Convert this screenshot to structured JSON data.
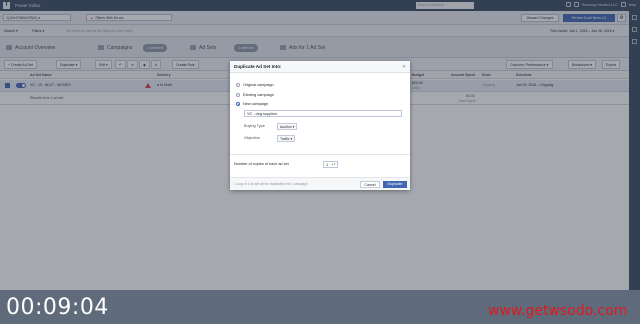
{
  "topbar": {
    "app_name": "Power Editor",
    "search_placeholder": "Search business",
    "account_name": "Runaway Vendors LLC",
    "help": "Help"
  },
  "subbar": {
    "account_id": "1(10047580497804) ▾",
    "filter_label": "Filters With Errors",
    "discard_label": "Discard Changes",
    "review_label": "Review Draft Items (1)"
  },
  "rowbar": {
    "search": "Search ▾",
    "filters": "Filters ▾",
    "hint": "Set filters to narrow the data you see easily",
    "date_range": "This month: Jan 1, 2016 – Jan 26, 2016 ▾"
  },
  "nav": {
    "account_overview": "Account Overview",
    "campaigns": "Campaigns",
    "campaigns_selected": "1 selected",
    "ad_sets": "Ad Sets",
    "ad_sets_selected": "1 selected",
    "ads_for": "Ads for 1 Ad Set"
  },
  "toolbar": {
    "create": "+ Create Ad Set",
    "duplicate": "Duplicate ▾",
    "edit": "Edit ▾",
    "create_rule": "Create Rule",
    "columns": "Columns: Performance ▾",
    "breakdown": "Breakdown ▾",
    "export": "Export"
  },
  "table": {
    "headers": [
      "Ad Set Name",
      "Delivery",
      "Budget",
      "Amount Spent",
      "Ends",
      "Schedule"
    ],
    "row1": {
      "name": "VC - 13 - W-UT - MOVIES",
      "delivery": "● In Draft",
      "budget": "$20.00",
      "budget_sub": "Daily",
      "ends": "Ongoing",
      "schedule": "Jan 29, 2016 – Ongoing"
    },
    "row2": {
      "name": "Results from 1 ad set",
      "spent": "$0.00",
      "spent_sub": "Total Spent"
    }
  },
  "modal": {
    "title": "Duplicate Ad Set Into:",
    "options": [
      "Original campaign",
      "Existing campaign",
      "New campaign"
    ],
    "selected_option": "New campaign",
    "campaign_name": "VC - dog supplies",
    "buying_type_label": "Buying Type",
    "buying_type_value": "Auction ▾",
    "objective_label": "Objective",
    "objective_value": "Traffic ▾",
    "copies_label": "Number of copies of each ad set",
    "copies_value": "1",
    "footnote": "1 copy of 1 ad set will be duplicated into 1 campaign",
    "cancel": "Cancel",
    "duplicate": "Duplicate"
  },
  "overlay": {
    "timer": "00:09:04",
    "watermark": "www.getwsodo.com"
  }
}
